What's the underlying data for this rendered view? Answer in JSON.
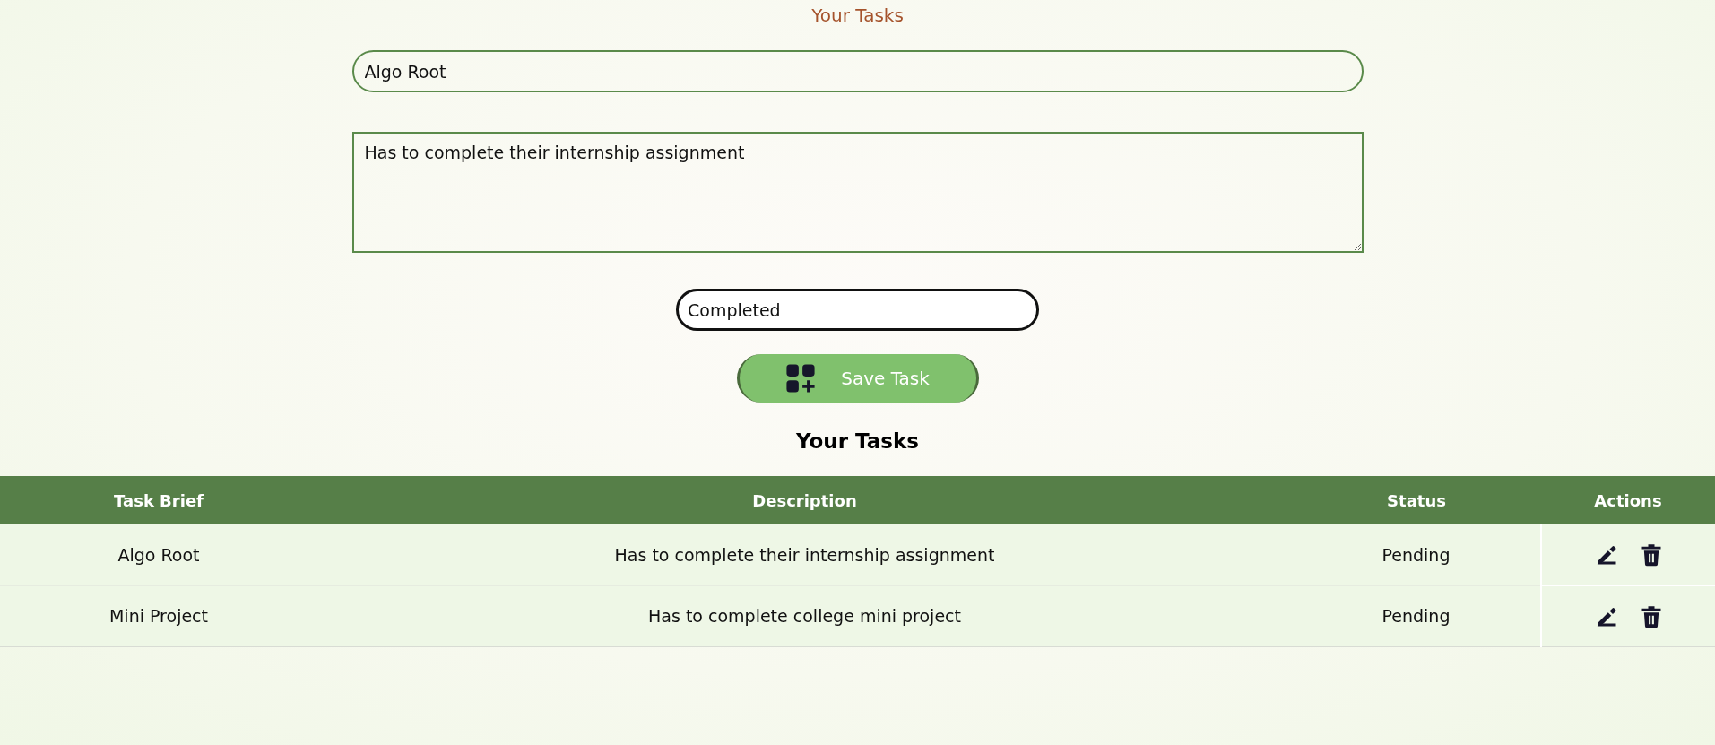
{
  "title": "Your Tasks",
  "form": {
    "task_brief": {
      "value": "Algo Root"
    },
    "description": {
      "value": "Has to complete their internship assignment"
    },
    "status": {
      "value": "Completed"
    },
    "save_button": {
      "label": "Save Task"
    }
  },
  "list_heading": "Your Tasks",
  "table": {
    "columns": [
      "Task Brief",
      "Description",
      "Status",
      "Actions"
    ],
    "rows": [
      {
        "task_brief": "Algo Root",
        "description": "Has to complete their internship assignment",
        "status": "Pending"
      },
      {
        "task_brief": "Mini Project",
        "description": "Has to complete college mini project",
        "status": "Pending"
      }
    ]
  }
}
